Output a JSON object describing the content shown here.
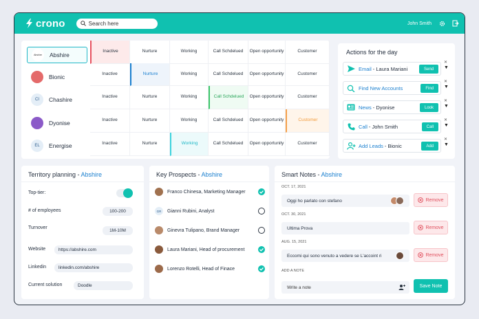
{
  "app": {
    "logo_text": "crono",
    "user_name": "John Smith"
  },
  "search": {
    "placeholder": "Search here"
  },
  "colors": {
    "accent": "#10c1b0",
    "link": "#1a7fcf",
    "danger": "#e0505e"
  },
  "pipeline": {
    "companies": [
      {
        "name": "Abshire",
        "avatar_text": "Abshire",
        "selected": true
      },
      {
        "name": "Bionic",
        "avatar_text": ""
      },
      {
        "name": "Chashire",
        "avatar_text": "CI"
      },
      {
        "name": "Dyonise",
        "avatar_text": ""
      },
      {
        "name": "Energise",
        "avatar_text": "EL"
      }
    ],
    "stages": [
      "Inactive",
      "Nurture",
      "Working",
      "Call Schdelued",
      "Open opportunity",
      "Customer"
    ],
    "active_stage_per_row": [
      0,
      1,
      3,
      5,
      2
    ]
  },
  "actions": {
    "title": "Actions for the day",
    "items": [
      {
        "icon": "send-icon",
        "verb": "Email",
        "rest": "- Laura Mariani",
        "button": "Send"
      },
      {
        "icon": "search-people-icon",
        "verb": "Find New Accounts",
        "rest": "",
        "button": "Find"
      },
      {
        "icon": "news-icon",
        "verb": "News",
        "rest": "- Dyonise",
        "button": "Look"
      },
      {
        "icon": "phone-icon",
        "verb": "Call",
        "rest": "- John Smith",
        "button": "Call"
      },
      {
        "icon": "add-user-icon",
        "verb": "Add Leads",
        "rest": "- Bionic",
        "button": "Add"
      }
    ]
  },
  "territory": {
    "title": "Territory planning - ",
    "company": "Abshire",
    "rows": [
      {
        "label": "Top-tier:",
        "value": "",
        "toggle": true
      },
      {
        "label": "# of employees",
        "value": "100-200"
      },
      {
        "label": "Turnover",
        "value": "1M-10M"
      },
      {
        "label": "Website",
        "value": "https://abshire.com"
      },
      {
        "label": "Linkedin",
        "value": "linkedin.com/abshire"
      },
      {
        "label": "Current solution",
        "value": "Doodle"
      }
    ]
  },
  "prospects": {
    "title": "Key Prospects - ",
    "company": "Abshire",
    "items": [
      {
        "name": "Franco Chinesa, Marketing Manager",
        "checked": true,
        "avatar_text": ""
      },
      {
        "name": "Gianni Rubini, Analyst",
        "checked": false,
        "avatar_text": "GR"
      },
      {
        "name": "Ginevra Tulipano, Brand Manager",
        "checked": false,
        "avatar_text": ""
      },
      {
        "name": "Laura Mariani, Head of procurement",
        "checked": true,
        "avatar_text": ""
      },
      {
        "name": "Lorenzo Rotelli, Head of Finace",
        "checked": true,
        "avatar_text": ""
      }
    ]
  },
  "notes": {
    "title": "Smart Notes - ",
    "company": "Abshire",
    "items": [
      {
        "date": "OCT. 17, 2021",
        "text": "Oggi ho parlato con stefano",
        "remove": "Remove"
      },
      {
        "date": "OCT. 30, 2021",
        "text": "Ultima Prova",
        "remove": "Remove"
      },
      {
        "date": "AUG. 15, 2021",
        "text": "Eccomi qui sono venuto a vedere se L'accoint ri",
        "remove": "Remove"
      }
    ],
    "add_label": "ADD A NOTE",
    "input_placeholder": "Write a note",
    "save_label": "Save Note"
  }
}
